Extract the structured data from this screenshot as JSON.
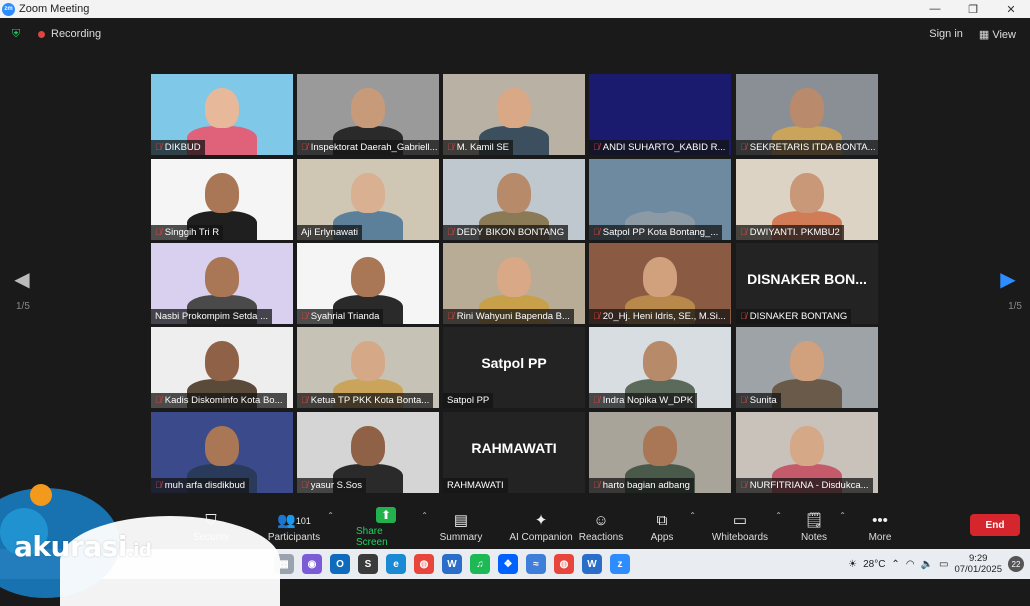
{
  "window": {
    "title": "Zoom Meeting",
    "minimize": "—",
    "restore": "❐",
    "close": "✕"
  },
  "topbar": {
    "recording_label": "Recording",
    "sign_in": "Sign in",
    "view": "View"
  },
  "pager": {
    "left_page": "1/5",
    "right_page": "1/5"
  },
  "tiles": [
    {
      "name": "DIKBUD",
      "muted": true,
      "bg": "#7fc8e8",
      "skin": "#e8b89a",
      "cloth": "#e0627a",
      "style": "photo"
    },
    {
      "name": "Inspektorat Daerah_Gabriell...",
      "muted": true,
      "bg": "#9a9a9a",
      "skin": "#c79a7a",
      "cloth": "#2a2a2a",
      "style": "photo"
    },
    {
      "name": "M. Kamil SE",
      "muted": true,
      "bg": "#b9b2a4",
      "skin": "#d8a887",
      "cloth": "#3c4f5e",
      "style": "photo"
    },
    {
      "name": "ANDI SUHARTO_KABID R...",
      "muted": true,
      "bg": "#1a1a6e",
      "skin": "#1a1a6e",
      "cloth": "#1a1a6e",
      "style": "photo"
    },
    {
      "name": "SEKRETARIS ITDA BONTA...",
      "muted": true,
      "bg": "#8a8f96",
      "skin": "#b98a6c",
      "cloth": "#c9a45a",
      "style": "photo"
    },
    {
      "name": "Singgih Tri R",
      "muted": true,
      "bg": "#f5f5f5",
      "skin": "#a97656",
      "cloth": "#1f1f1f",
      "style": "photo"
    },
    {
      "name": "Aji Erlynawati",
      "muted": false,
      "bg": "#cfc6b4",
      "skin": "#d9b092",
      "cloth": "#5c7f9a",
      "style": "photo"
    },
    {
      "name": "DEDY BIKON BONTANG",
      "muted": true,
      "bg": "#c0c8cf",
      "skin": "#b78a6a",
      "cloth": "#8a7a55",
      "style": "photo"
    },
    {
      "name": "Satpol PP Kota Bontang_...",
      "muted": true,
      "bg": "#6e8aa0",
      "skin": "#6e8aa0",
      "cloth": "#8c9aa6",
      "style": "photo"
    },
    {
      "name": "DWIYANTI. PKMBU2",
      "muted": true,
      "bg": "#ddd3c4",
      "skin": "#c89878",
      "cloth": "#d17b57",
      "style": "photo"
    },
    {
      "name": "Nasbi Prokompim Setda ...",
      "muted": false,
      "bg": "#d8d0ee",
      "skin": "#a97656",
      "cloth": "#4a4a4a",
      "style": "photo"
    },
    {
      "name": "Syahrial Trianda",
      "muted": true,
      "bg": "#f5f5f5",
      "skin": "#a97656",
      "cloth": "#2a2a2a",
      "style": "photo"
    },
    {
      "name": "Rini Wahyuni Bapenda B...",
      "muted": true,
      "bg": "#b8ac96",
      "skin": "#d8a887",
      "cloth": "#c9a04a",
      "style": "photo"
    },
    {
      "name": "20_Hj. Heni Idris, SE., M.Si...",
      "muted": true,
      "bg": "#8a5a42",
      "skin": "#d1a07c",
      "cloth": "#b8894a",
      "style": "photo"
    },
    {
      "name": "DISNAKER BONTANG",
      "muted": true,
      "bg": "#232323",
      "text": "DISNAKER BON...",
      "style": "name"
    },
    {
      "name": "Kadis Diskominfo Kota Bo...",
      "muted": true,
      "bg": "#eeeeee",
      "skin": "#8f6248",
      "cloth": "#5a4a3a",
      "style": "photo"
    },
    {
      "name": "Ketua TP PKK Kota Bonta...",
      "muted": true,
      "bg": "#c7c2b6",
      "skin": "#d5a888",
      "cloth": "#c9a45a",
      "style": "photo"
    },
    {
      "name": "Satpol PP",
      "muted": false,
      "bg": "#232323",
      "text": "Satpol PP",
      "style": "name",
      "active": true
    },
    {
      "name": "Indra Nopika W_DPK",
      "muted": true,
      "bg": "#d8dde2",
      "skin": "#b78a6a",
      "cloth": "#5b6a5a",
      "style": "photo"
    },
    {
      "name": "Sunita",
      "muted": true,
      "bg": "#9ea3a8",
      "skin": "#d1a07c",
      "cloth": "#6a5a4a",
      "style": "photo"
    },
    {
      "name": "muh arfa disdikbud",
      "muted": true,
      "bg": "#3a4a8a",
      "skin": "#a97656",
      "cloth": "#2a3a5a",
      "style": "photo"
    },
    {
      "name": "yasur S.Sos",
      "muted": true,
      "bg": "#d5d5d5",
      "skin": "#8f6248",
      "cloth": "#2a2a2a",
      "style": "photo"
    },
    {
      "name": "RAHMAWATI",
      "muted": false,
      "bg": "#232323",
      "text": "RAHMAWATI",
      "style": "name"
    },
    {
      "name": "harto bagian adbang",
      "muted": true,
      "bg": "#a8a49a",
      "skin": "#a97656",
      "cloth": "#4a5a4a",
      "style": "photo"
    },
    {
      "name": "NURFITRIANA - Disdukca...",
      "muted": true,
      "bg": "#c9c2ba",
      "skin": "#d5a888",
      "cloth": "#c45a6a",
      "style": "photo"
    }
  ],
  "toolbar": {
    "security": "Security",
    "participants": "Participants",
    "participants_count": "101",
    "share": "Share Screen",
    "summary": "Summary",
    "ai": "AI Companion",
    "reactions": "Reactions",
    "apps": "Apps",
    "whiteboards": "Whiteboards",
    "notes": "Notes",
    "more": "More",
    "end": "End"
  },
  "taskbar": {
    "temperature": "28°C",
    "time": "9:29",
    "date": "07/01/2025",
    "notifications": "22"
  },
  "brand": {
    "wordmark": "akurasi",
    "suffix": ".id"
  },
  "colors": {
    "accent": "#2d8cff",
    "share_green": "#23b14d",
    "end_red": "#d4262c",
    "active_outline": "#c8d85a"
  }
}
